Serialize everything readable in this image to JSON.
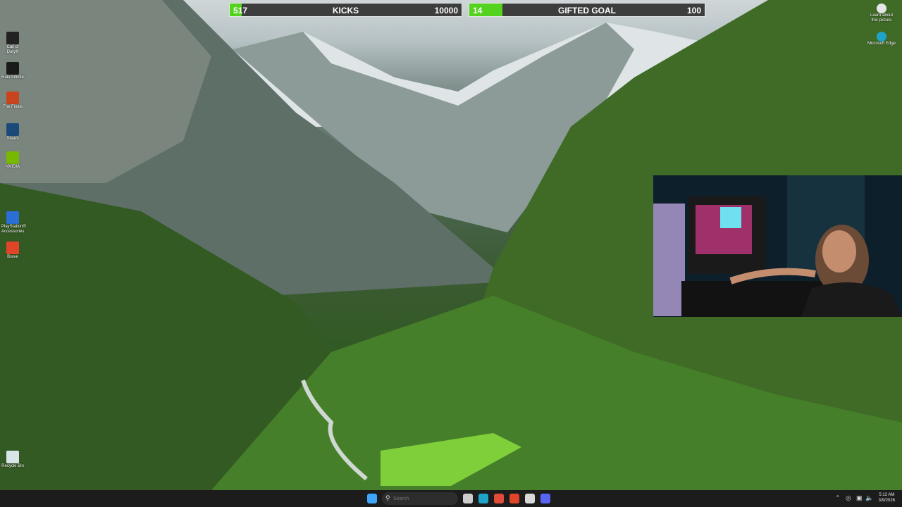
{
  "goals": {
    "kicks": {
      "current": "517",
      "label": "KICKS",
      "target": "10000",
      "fraction": 0.0517
    },
    "gifted": {
      "current": "14",
      "label": "GIFTED GOAL",
      "target": "100",
      "fraction": 0.14
    }
  },
  "desktop_icons_left": [
    {
      "label": "Call of Duty®",
      "icon": "call-of-duty-icon",
      "color": "#222222"
    },
    {
      "label": "Halo Infinite",
      "icon": "halo-icon",
      "color": "#1a1a1a"
    },
    {
      "label": "The Finals",
      "icon": "the-finals-icon",
      "color": "#c8441c"
    },
    {
      "label": "Steam",
      "icon": "steam-icon",
      "color": "#1b4a7a"
    },
    {
      "label": "NVIDIA",
      "icon": "nvidia-icon",
      "color": "#76b900"
    },
    {
      "label": "PlayStation® Accessories",
      "icon": "playstation-icon",
      "color": "#2a6fd6"
    },
    {
      "label": "Brave",
      "icon": "brave-icon",
      "color": "#e0452a"
    },
    {
      "label": "Recycle Bin",
      "icon": "recycle-bin-icon",
      "color": "#d8e6ea"
    }
  ],
  "desktop_icons_right": [
    {
      "label": "Learn about this picture",
      "icon": "learn-about-picture-icon"
    },
    {
      "label": "Microsoft Edge",
      "icon": "edge-icon"
    }
  ],
  "taskbar": {
    "search_placeholder": "Search",
    "apps": [
      {
        "icon": "start-icon",
        "color": "#3ea6ff"
      },
      {
        "icon": "task-view-icon",
        "color": "#cccccc"
      },
      {
        "icon": "edge-icon",
        "color": "#1fa3c8"
      },
      {
        "icon": "chrome-icon",
        "color": "#e04b3a"
      },
      {
        "icon": "brave-icon",
        "color": "#e0452a"
      },
      {
        "icon": "obs-icon",
        "color": "#d8d8d8"
      },
      {
        "icon": "discord-icon",
        "color": "#5865f2"
      }
    ],
    "time": "5:12 AM",
    "date": "3/9/2026"
  },
  "colors": {
    "goal_fill": "#53d21e",
    "goal_bg": "#3d3d3d",
    "taskbar": "#1c1c1c"
  }
}
